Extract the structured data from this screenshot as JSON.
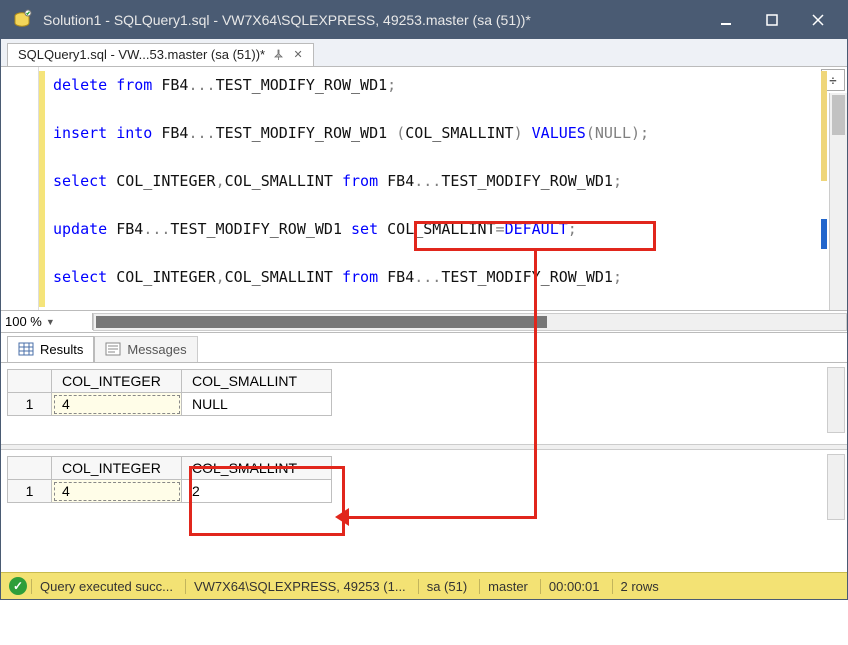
{
  "window": {
    "title": "Solution1 - SQLQuery1.sql - VW7X64\\SQLEXPRESS, 49253.master (sa (51))*"
  },
  "tab": {
    "label": "SQLQuery1.sql - VW...53.master (sa (51))*"
  },
  "editor": {
    "zoom": "100 %",
    "code": {
      "l1": {
        "kw1": "delete",
        "kw2": "from",
        "rest": " FB4",
        "dots": "...",
        "name": "TEST_MODIFY_ROW_WD1",
        "end": ";"
      },
      "l2": {
        "kw1": "insert",
        "kw2": "into",
        "rest": " FB4",
        "dots": "...",
        "name": "TEST_MODIFY_ROW_WD1 ",
        "paren1": "(",
        "col": "COL_SMALLINT",
        "paren2": ") ",
        "vals": "VALUES",
        "paren3": "(",
        "nul": "NULL",
        "paren4": ");"
      },
      "l3": {
        "kw": "select",
        "cols": " COL_INTEGER",
        "comma": ",",
        "col2": "COL_SMALLINT ",
        "from": "from",
        "rest": " FB4",
        "dots": "...",
        "name": "TEST_MODIFY_ROW_WD1",
        "end": ";"
      },
      "l4": {
        "kw": "update",
        "rest": " FB4",
        "dots": "...",
        "name": "TEST_MODIFY_ROW_WD1 ",
        "set": "set",
        "sp": " ",
        "col": "COL_SMALLINT",
        "eq": "=",
        "def": "DEFAULT",
        "end": ";"
      },
      "l5": {
        "kw": "select",
        "cols": " COL_INTEGER",
        "comma": ",",
        "col2": "COL_SMALLINT ",
        "from": "from",
        "rest": " FB4",
        "dots": "...",
        "name": "TEST_MODIFY_ROW_WD1",
        "end": ";"
      }
    }
  },
  "results_tabs": {
    "results": "Results",
    "messages": "Messages"
  },
  "grid1": {
    "headers": [
      "COL_INTEGER",
      "COL_SMALLINT"
    ],
    "rownum": "1",
    "row": [
      "4",
      "NULL"
    ]
  },
  "grid2": {
    "headers": [
      "COL_INTEGER",
      "COL_SMALLINT"
    ],
    "rownum": "1",
    "row": [
      "4",
      "2"
    ]
  },
  "status": {
    "msg": "Query executed succ...",
    "server": "VW7X64\\SQLEXPRESS, 49253 (1...",
    "user": "sa (51)",
    "db": "master",
    "time": "00:00:01",
    "rows": "2 rows"
  }
}
